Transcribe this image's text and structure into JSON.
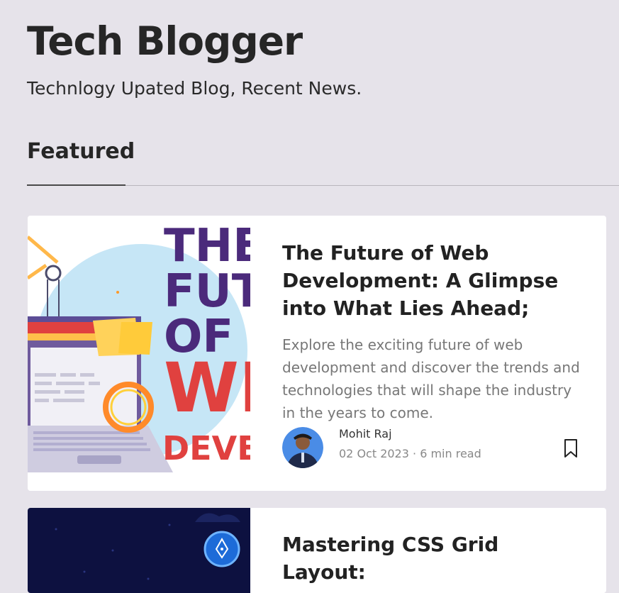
{
  "site": {
    "title": "Tech Blogger",
    "tagline": "Technlogy Upated Blog, Recent News."
  },
  "section": {
    "heading": "Featured"
  },
  "posts": [
    {
      "title": "The Future of Web Development: A Glimpse into What Lies Ahead;",
      "description": "Explore the exciting future of web development and discover the trends and technologies that will shape the industry in the years to come.",
      "author": "Mohit Raj",
      "date": "02 Oct 2023",
      "read_time": "6 min read",
      "meta_separator": " · ",
      "thumbnail_text": [
        "THE",
        "FUT",
        "OF",
        "WE",
        "DEVE"
      ]
    },
    {
      "title": "Mastering CSS Grid Layout:"
    }
  ],
  "icons": {
    "bookmark": "bookmark-icon"
  },
  "colors": {
    "background": "#e6e3ea",
    "card": "#ffffff",
    "thumb_purple": "#4b2a7b",
    "thumb_red": "#e0413f",
    "thumb_blue": "#c6e6f6",
    "thumb2_navy": "#0d1140"
  }
}
